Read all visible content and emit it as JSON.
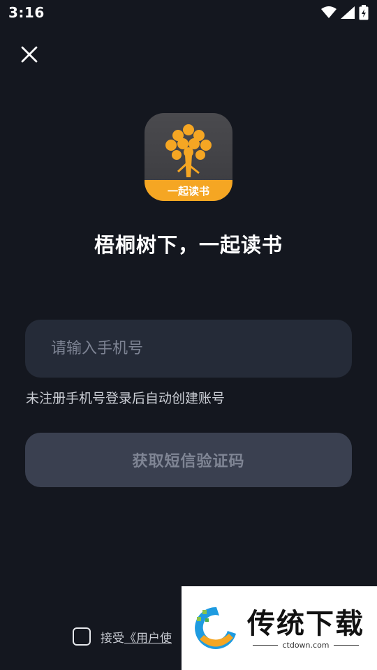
{
  "status_bar": {
    "time": "3:16"
  },
  "logo": {
    "band_text": "一起读书"
  },
  "slogan": "梧桐树下，一起读书",
  "phone_input": {
    "placeholder": "请输入手机号",
    "value": ""
  },
  "hint": "未注册手机号登录后自动创建账号",
  "sms_button": {
    "label": "获取短信验证码"
  },
  "agreement": {
    "prefix": "接受",
    "link": "《用户使"
  },
  "watermark": {
    "title": "传统下载",
    "url": "ctdown.com"
  },
  "colors": {
    "background": "#14171f",
    "input_bg": "#252b38",
    "button_bg": "#3a4050",
    "logo_accent": "#f5a623"
  }
}
